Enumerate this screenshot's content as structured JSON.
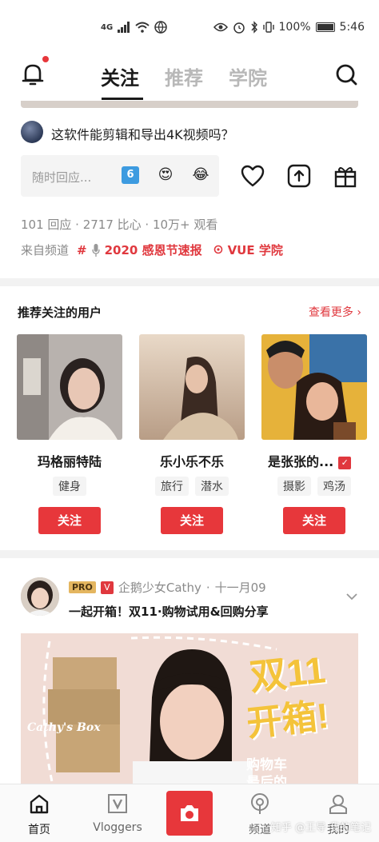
{
  "statusbar": {
    "network": "4G",
    "battery": "100%",
    "time": "5:46"
  },
  "topnav": {
    "tabs": [
      "关注",
      "推荐",
      "学院"
    ],
    "active_tab": "关注"
  },
  "question": {
    "title": "这软件能剪辑和导出4K视频吗？",
    "reply_placeholder": "随时回应...",
    "emojis": [
      "6",
      "😍",
      "😂"
    ],
    "stats": "101 回应 · 2717 比心 · 10万+ 观看",
    "channel_label": "来自频道",
    "channels": [
      "2020 感恩节速报",
      "VUE 学院"
    ]
  },
  "recommend": {
    "title": "推荐关注的用户",
    "more": "查看更多",
    "users": [
      {
        "name": "玛格丽特陆",
        "tags": [
          "健身"
        ],
        "follow": "关注",
        "verified": false
      },
      {
        "name": "乐小乐不乐",
        "tags": [
          "旅行",
          "潜水"
        ],
        "follow": "关注",
        "verified": false
      },
      {
        "name": "是张张的...",
        "tags": [
          "摄影",
          "鸡汤"
        ],
        "follow": "关注",
        "verified": true
      }
    ]
  },
  "post": {
    "pro_badge": "PRO",
    "verified_badge": "V",
    "author": "企鹅少女Cathy",
    "date": "十一月09",
    "title": "一起开箱！双11·购物试用&回购分享",
    "cover_text_1": "双11",
    "cover_text_2": "开箱!",
    "cover_text_3": "购物车",
    "cover_text_4": "最后的",
    "cover_box_label": "Cathy's Box"
  },
  "bottomnav": {
    "items": [
      "首页",
      "Vloggers",
      "频道",
      "我的"
    ],
    "active": "首页"
  },
  "watermark": "知乎 @王导 我的笔记",
  "colors": {
    "accent": "#e7373b",
    "tab_inactive": "#b8b8b8",
    "meta_gray": "#8a8a8a"
  }
}
